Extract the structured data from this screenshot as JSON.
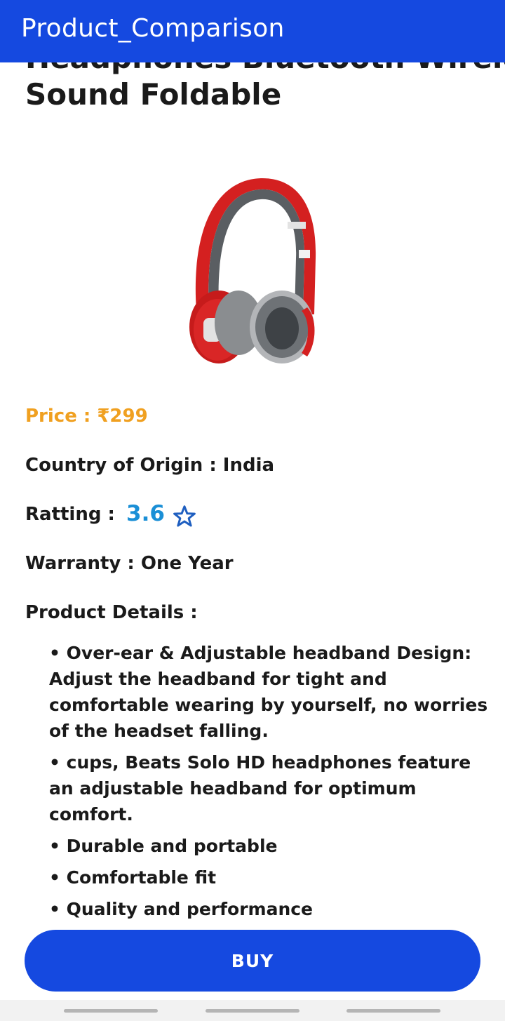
{
  "app_bar": {
    "title": "Product_Comparison"
  },
  "product": {
    "title_partial": "Headphones Bluetooth Wireless",
    "title": "Sound Foldable",
    "image_icon": "headphones-image",
    "price_label": "Price : ₹299",
    "origin_label": "Country of Origin : India",
    "rating_label": "Ratting :",
    "rating_value": "3.6",
    "rating_icon": "star-icon",
    "warranty_label": "Warranty : One Year",
    "details_label": "Product Details :",
    "details": [
      "• Over-ear & Adjustable headband Design: Adjust the headband for tight and comfortable wearing by yourself, no worries of the headset falling.",
      "• cups, Beats Solo HD headphones feature an adjustable headband for optimum comfort.",
      "• Durable and portable",
      "• Comfortable fit",
      "• Quality and performance"
    ]
  },
  "buy_button": {
    "label": "BUY"
  },
  "colors": {
    "primary": "#1549e0",
    "price": "#f0a020",
    "rating": "#1a8fd6"
  }
}
